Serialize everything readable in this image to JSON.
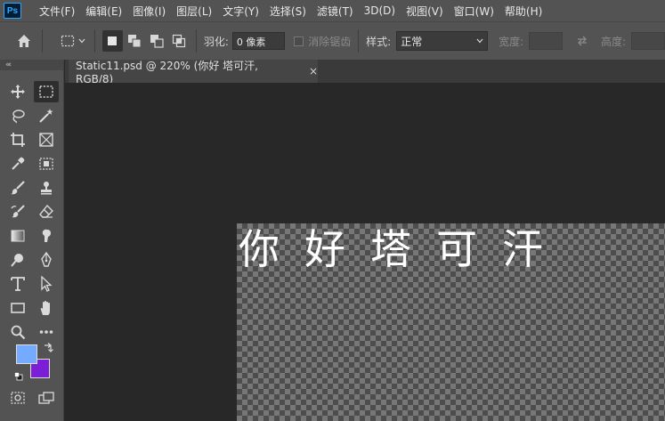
{
  "app": {
    "logo": "Ps"
  },
  "menu": [
    "文件(F)",
    "编辑(E)",
    "图像(I)",
    "图层(L)",
    "文字(Y)",
    "选择(S)",
    "滤镜(T)",
    "3D(D)",
    "视图(V)",
    "窗口(W)",
    "帮助(H)"
  ],
  "options": {
    "feather_label": "羽化:",
    "feather_value": "0 像素",
    "antialias_label": "消除锯齿",
    "style_label": "样式:",
    "style_value": "正常",
    "width_label": "宽度:",
    "height_label": "高度:"
  },
  "toolbar": {
    "collapse_glyph": "«‹"
  },
  "tab": {
    "title": "Static11.psd @ 220% (你好 塔可汗, RGB/8)",
    "close": "×"
  },
  "document": {
    "text": "你好塔可汗"
  },
  "colors": {
    "foreground": "#74aaff",
    "background": "#7b1fd6",
    "ui_panel": "#535353",
    "canvas_bg": "#282828"
  }
}
